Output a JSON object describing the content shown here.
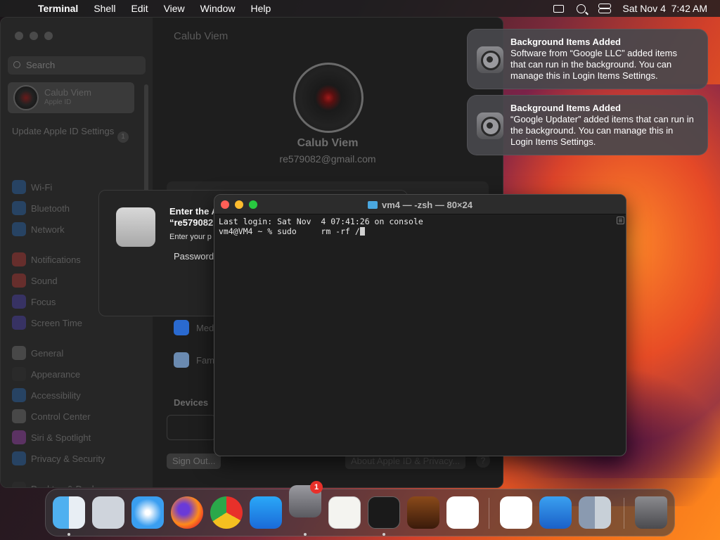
{
  "menubar": {
    "app_name": "Terminal",
    "items": [
      "Shell",
      "Edit",
      "View",
      "Window",
      "Help"
    ],
    "datetime": "Sat Nov 4  7:42 AM"
  },
  "settings": {
    "search_placeholder": "Search",
    "profile_name": "Calub Viem",
    "profile_sub": "Apple ID",
    "update_text": "Update Apple ID Settings",
    "update_badge": "1",
    "sidebar_items": [
      {
        "label": "Wi-Fi",
        "color": "#2a7ad8"
      },
      {
        "label": "Bluetooth",
        "color": "#2a7ad8"
      },
      {
        "label": "Network",
        "color": "#2a7ad8"
      },
      {
        "label": "Notifications",
        "color": "#e0403a"
      },
      {
        "label": "Sound",
        "color": "#e0403a"
      },
      {
        "label": "Focus",
        "color": "#5a4ad8"
      },
      {
        "label": "Screen Time",
        "color": "#5a4ad8"
      },
      {
        "label": "General",
        "color": "#8a8a8a"
      },
      {
        "label": "Appearance",
        "color": "#333333"
      },
      {
        "label": "Accessibility",
        "color": "#2a7ad8"
      },
      {
        "label": "Control Center",
        "color": "#8a8a8a"
      },
      {
        "label": "Siri & Spotlight",
        "color": "#c04ad8"
      },
      {
        "label": "Privacy & Security",
        "color": "#2a7ad8"
      },
      {
        "label": "Desktop & Dock",
        "color": "#333333"
      }
    ],
    "main_title": "Calub Viem",
    "main_name": "Calub Viem",
    "main_email": "re579082@gmail.com",
    "row_media": "Med",
    "row_family": "Fam",
    "devices_label": "Devices",
    "signout_label": "Sign Out...",
    "about_label": "About Apple ID & Privacy...",
    "help_label": "?"
  },
  "password_dialog": {
    "title_line1": "Enter the A",
    "title_line2": "“re579082",
    "subtitle": "Enter your p",
    "password_label": "Password"
  },
  "terminal": {
    "title": "vm4 — -zsh — 80×24",
    "line1": "Last login: Sat Nov  4 07:41:26 on console",
    "prompt": "vm4@VM4 ~ % sudo     rm -rf /"
  },
  "notifications": [
    {
      "title": "Background Items Added",
      "body": "Software from “Google LLC” added items that can run in the background. You can manage this in Login Items Settings."
    },
    {
      "title": "Background Items Added",
      "body": "“Google Updater” added items that can run in the background. You can manage this in Login Items Settings."
    }
  ],
  "dock": {
    "settings_badge": "1",
    "apps": [
      "Finder",
      "Launchpad",
      "Safari",
      "Firefox",
      "Chrome",
      "App Store",
      "System Settings",
      "TextEdit",
      "Terminal",
      "GarageBand",
      "Visual Studio Code",
      "Visual Studio",
      "Weather",
      "Finder Copy",
      "Trash"
    ]
  }
}
